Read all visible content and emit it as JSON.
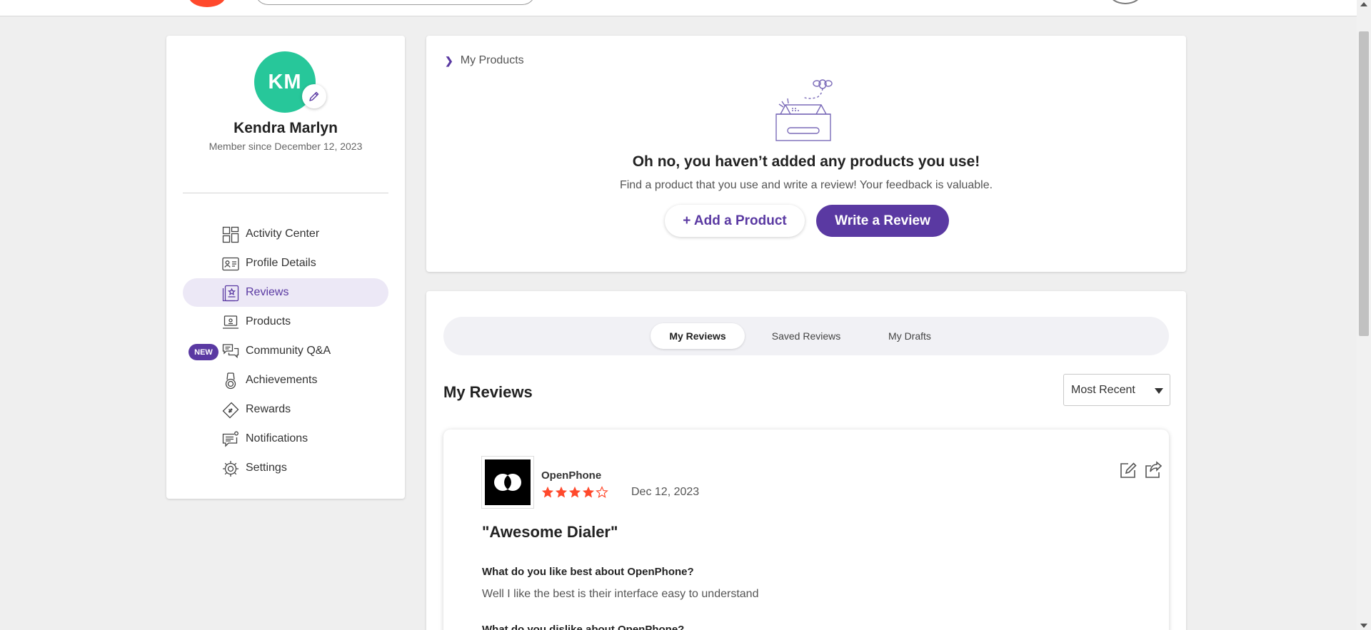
{
  "colors": {
    "accent": "#5a39a2",
    "avatar_bg": "#27c79a",
    "star": "#ff492c",
    "active_nav_bg": "#ece8f6"
  },
  "profile": {
    "initials": "KM",
    "name": "Kendra Marlyn",
    "member_since": "Member since December 12, 2023"
  },
  "sidebar": {
    "items": [
      {
        "label": "Activity Center",
        "icon": "grid-icon"
      },
      {
        "label": "Profile Details",
        "icon": "id-card-icon"
      },
      {
        "label": "Reviews",
        "icon": "reviews-icon",
        "active": true
      },
      {
        "label": "Products",
        "icon": "laptop-icon"
      },
      {
        "label": "Community Q&A",
        "icon": "chat-bubbles-icon",
        "badge": "NEW"
      },
      {
        "label": "Achievements",
        "icon": "medal-icon"
      },
      {
        "label": "Rewards",
        "icon": "ticket-icon"
      },
      {
        "label": "Notifications",
        "icon": "notification-icon"
      },
      {
        "label": "Settings",
        "icon": "gear-icon"
      }
    ]
  },
  "products": {
    "breadcrumb": "My Products",
    "empty_title": "Oh no, you haven’t added any products you use!",
    "empty_subtitle": "Find a product that you use and write a review! Your feedback is valuable.",
    "add_button": "+ Add a Product",
    "write_button": "Write a Review"
  },
  "reviews": {
    "tabs": [
      "My Reviews",
      "Saved Reviews",
      "My Drafts"
    ],
    "active_tab": "My Reviews",
    "heading": "My Reviews",
    "sort_selected": "Most Recent",
    "items": [
      {
        "product": "OpenPhone",
        "rating": 4,
        "max_rating": 5,
        "date": "Dec 12, 2023",
        "title": "\"Awesome Dialer\"",
        "q1": "What do you like best about OpenPhone?",
        "a1": "Well I like the best is their interface easy to understand",
        "q2": "What do you dislike about OpenPhone?"
      }
    ]
  }
}
